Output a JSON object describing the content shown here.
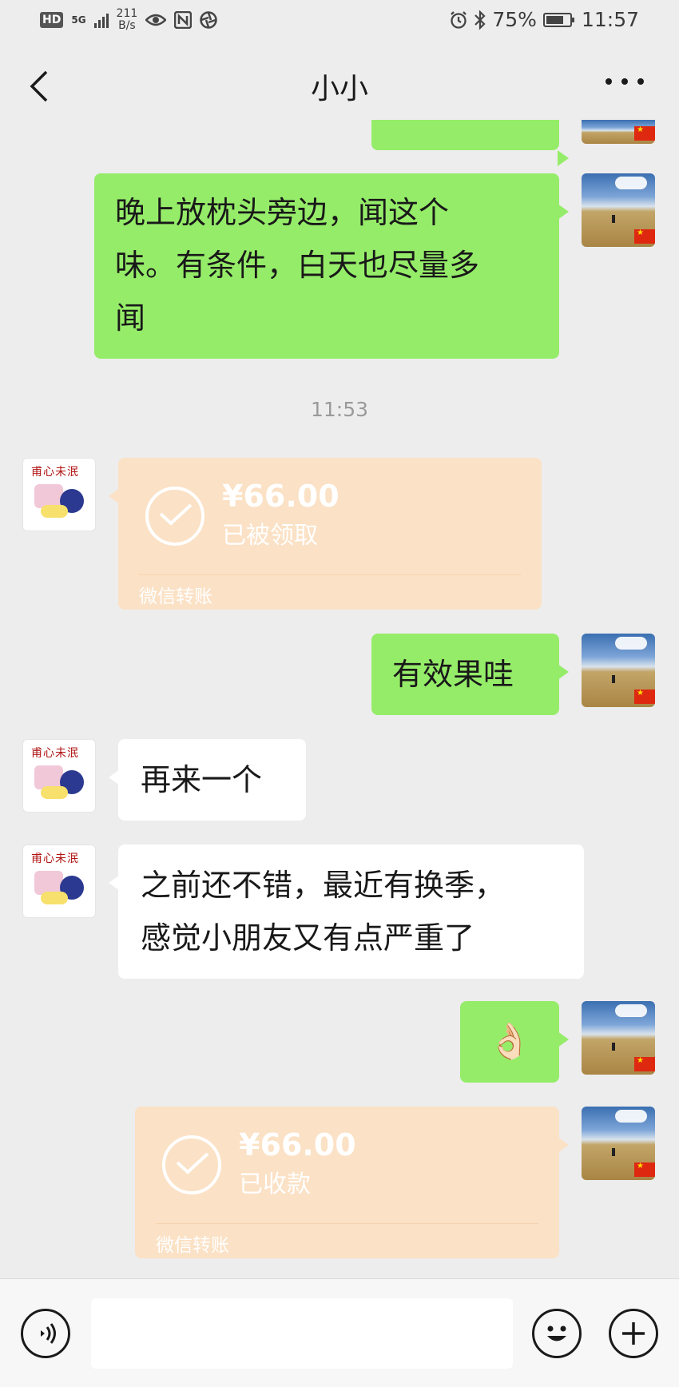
{
  "status_bar": {
    "network": "HD",
    "signal": "5G",
    "speed_value": "211",
    "speed_unit": "B/s",
    "battery": "75%",
    "battery_level": 0.75,
    "time": "11:57"
  },
  "header": {
    "title": "小小",
    "back_icon": "chevron-left-icon",
    "more_icon": "more-dots-icon"
  },
  "avatars": {
    "other_caption": "甫心未泯"
  },
  "messages": [
    {
      "type": "text",
      "sender": "me",
      "lines": [
        "晚上放枕头旁边，闻这个",
        "味。有条件，白天也尽量多",
        "闻"
      ]
    },
    {
      "type": "time",
      "text": "11:53"
    },
    {
      "type": "transfer",
      "sender": "other",
      "amount": "¥66.00",
      "status": "已被领取",
      "label": "微信转账"
    },
    {
      "type": "text",
      "sender": "me",
      "lines": [
        "有效果哇"
      ]
    },
    {
      "type": "text",
      "sender": "other",
      "lines": [
        "再来一个"
      ]
    },
    {
      "type": "text",
      "sender": "other",
      "lines": [
        "之前还不错，最近有换季，",
        "感觉小朋友又有点严重了"
      ]
    },
    {
      "type": "emoji",
      "sender": "me",
      "text": "👌🏻"
    },
    {
      "type": "transfer",
      "sender": "me",
      "amount": "¥66.00",
      "status": "已收款",
      "label": "微信转账"
    }
  ],
  "input_bar": {
    "voice_icon": "voice-icon",
    "emoji_icon": "emoji-icon",
    "plus_icon": "plus-icon",
    "text_value": ""
  },
  "colors": {
    "my_bubble": "#95ec69",
    "their_bubble": "#ffffff",
    "transfer": "#fbe1c5",
    "background": "#ededed"
  }
}
